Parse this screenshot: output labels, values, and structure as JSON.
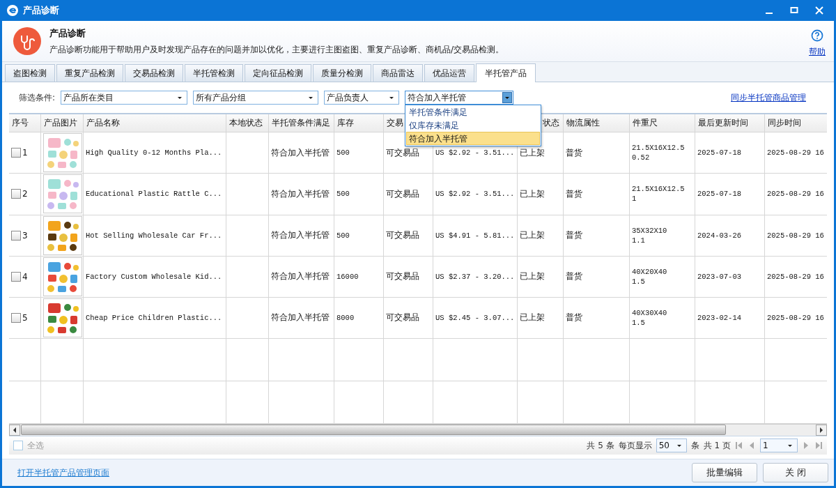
{
  "window": {
    "title": "产品诊断"
  },
  "header": {
    "title": "产品诊断",
    "description": "产品诊断功能用于帮助用户及时发现产品存在的问题并加以优化，主要进行主图盗图、重复产品诊断、商机品/交易品检测。",
    "help_link": "帮助"
  },
  "tabs": [
    {
      "label": "盗图检测",
      "selected": false
    },
    {
      "label": "重复产品检测",
      "selected": false
    },
    {
      "label": "交易品检测",
      "selected": false
    },
    {
      "label": "半托管检测",
      "selected": false
    },
    {
      "label": "定向征品检测",
      "selected": false
    },
    {
      "label": "质量分检测",
      "selected": false
    },
    {
      "label": "商品雷达",
      "selected": false
    },
    {
      "label": "优品运营",
      "selected": false
    },
    {
      "label": "半托管产品",
      "selected": true
    }
  ],
  "filters": {
    "label": "筛选条件:",
    "category": "产品所在类目",
    "group": "所有产品分组",
    "owner": "产品负责人",
    "condition": "符合加入半托管",
    "sync_link": "同步半托管商品管理",
    "condition_options": [
      {
        "label": "半托管条件满足",
        "selected": false
      },
      {
        "label": "仅库存未满足",
        "selected": false
      },
      {
        "label": "符合加入半托管",
        "selected": true
      }
    ]
  },
  "table": {
    "columns": [
      "序号",
      "产品图片",
      "产品名称",
      "本地状态",
      "半托管条件满足",
      "库存",
      "交易",
      "状态",
      "物流属性",
      "件重尺",
      "最后更新时间",
      "同步时间"
    ],
    "rows": [
      {
        "no": "1",
        "checked": false,
        "name": "High Quality 0-12 Months Pla...",
        "condition": "符合加入半托管",
        "stock": "500",
        "trade": "可交易品",
        "price": "US $2.92 - 3.51...",
        "listing": "已上架",
        "logistics": "普货",
        "size": "21.5X16X12.5",
        "weight": "0.52",
        "updated": "2025-07-18",
        "synced": "2025-08-29 16"
      },
      {
        "no": "2",
        "checked": false,
        "name": "Educational Plastic Rattle C...",
        "condition": "符合加入半托管",
        "stock": "500",
        "trade": "可交易品",
        "price": "US $2.92 - 3.51...",
        "listing": "已上架",
        "logistics": "普货",
        "size": "21.5X16X12.5",
        "weight": "1",
        "updated": "2025-07-18",
        "synced": "2025-08-29 16"
      },
      {
        "no": "3",
        "checked": false,
        "name": "Hot Selling Wholesale Car Fr...",
        "condition": "符合加入半托管",
        "stock": "500",
        "trade": "可交易品",
        "price": "US $4.91 - 5.81...",
        "listing": "已上架",
        "logistics": "普货",
        "size": "35X32X10",
        "weight": "1.1",
        "updated": "2024-03-26",
        "synced": "2025-08-29 16"
      },
      {
        "no": "4",
        "checked": false,
        "name": "Factory Custom Wholesale Kid...",
        "condition": "符合加入半托管",
        "stock": "16000",
        "trade": "可交易品",
        "price": "US $2.37 - 3.20...",
        "listing": "已上架",
        "logistics": "普货",
        "size": "40X20X40",
        "weight": "1.5",
        "updated": "2023-07-03",
        "synced": "2025-08-29 16"
      },
      {
        "no": "5",
        "checked": false,
        "name": "Cheap Price Children Plastic...",
        "condition": "符合加入半托管",
        "stock": "8000",
        "trade": "可交易品",
        "price": "US $2.45 - 3.07...",
        "listing": "已上架",
        "logistics": "普货",
        "size": "40X30X40",
        "weight": "1.5",
        "updated": "2023-02-14",
        "synced": "2025-08-29 16"
      }
    ]
  },
  "footer": {
    "select_all": {
      "label": "全选",
      "checked": false
    },
    "total": "共 5 条",
    "per_page_label": "每页显示",
    "per_page": "50",
    "per_page_unit": "条",
    "pages": "共 1 页",
    "page": "1"
  },
  "bottom": {
    "link": "打开半托管产品管理页面",
    "buttons": [
      "批量编辑",
      "关 闭"
    ]
  }
}
